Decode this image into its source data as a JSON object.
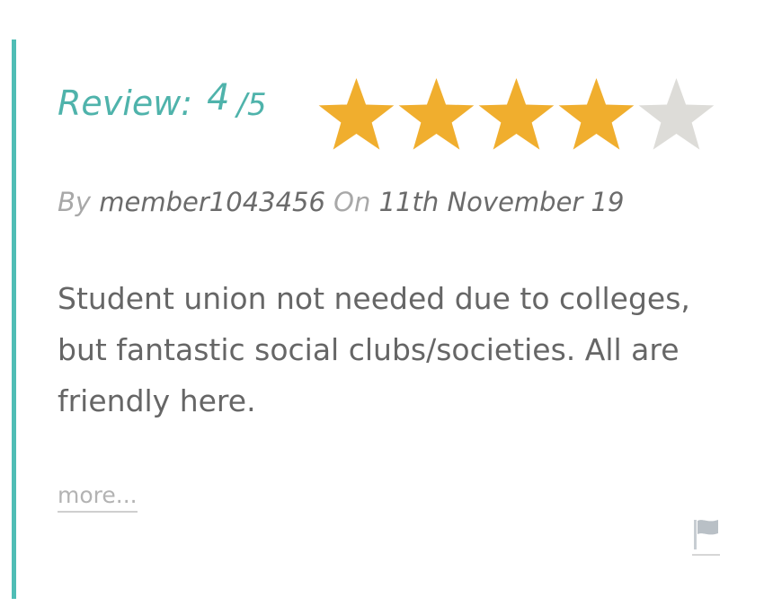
{
  "review": {
    "label": "Review:",
    "score": "4",
    "slash": "/",
    "max": "5",
    "rating_value": 4,
    "rating_max": 5,
    "accent_color": "#4fbdb5",
    "star_filled_color": "#f0ae2e",
    "star_empty_color": "#dddcd8"
  },
  "byline": {
    "by_label": "By",
    "author": "member1043456",
    "on_label": "On",
    "date": "11th November 19"
  },
  "body": {
    "text": "Student union not needed due to colleges, but fantastic social clubs/societies. All are friendly here."
  },
  "actions": {
    "more_label": "more...",
    "flag_icon": "flag-icon"
  }
}
